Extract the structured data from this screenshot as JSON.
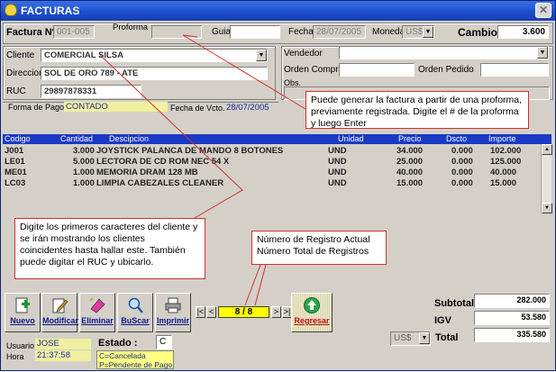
{
  "window": {
    "title": "FACTURAS"
  },
  "header": {
    "factura_label": "Factura Nº",
    "factura_value": "001-005",
    "proforma_label": "Proforma",
    "proforma_value": "",
    "guia_label": "Guia",
    "guia_value": "",
    "fecha_label": "Fecha:",
    "fecha_value": "28/07/2005",
    "moneda_label": "Moneda",
    "moneda_value": "US$",
    "cambio_label": "Cambio",
    "cambio_value": "3.600"
  },
  "client": {
    "cliente_label": "Cliente",
    "cliente_value": "COMERCIAL SILSA",
    "direccion_label": "Direccion",
    "direccion_value": "SOL DE ORO 789  - ATE",
    "ruc_label": "RUC",
    "ruc_value": "29897878331",
    "vendedor_label": "Vendedor",
    "vendedor_value": "",
    "orden_compra_label": "Orden Compra",
    "orden_compra_value": "",
    "orden_pedido_label": "Orden Pedido",
    "orden_pedido_value": "",
    "obs_label": "Obs."
  },
  "payment": {
    "forma_label": "Forma de Pago",
    "forma_value": "CONTADO",
    "vcto_label": "Fecha de Vcto.",
    "vcto_value": "28/07/2005"
  },
  "grid": {
    "columns": [
      "Codigo",
      "Cantidad",
      "Descipcion",
      "Unidad",
      "Precio",
      "Dscto",
      "Importe"
    ],
    "rows": [
      {
        "codigo": "J001",
        "cantidad": "3.000",
        "descripcion": "JOYSTICK PALANCA DE MANDO 8 BOTONES",
        "unidad": "UND",
        "precio": "34.000",
        "dscto": "0.000",
        "importe": "102.000"
      },
      {
        "codigo": "LE01",
        "cantidad": "5.000",
        "descripcion": "LECTORA DE CD ROM NEC 54 X",
        "unidad": "UND",
        "precio": "25.000",
        "dscto": "0.000",
        "importe": "125.000"
      },
      {
        "codigo": "ME01",
        "cantidad": "1.000",
        "descripcion": "MEMORIA DRAM 128 MB",
        "unidad": "UND",
        "precio": "40.000",
        "dscto": "0.000",
        "importe": "40.000"
      },
      {
        "codigo": "LC03",
        "cantidad": "1.000",
        "descripcion": "LIMPIA CABEZALES CLEANER",
        "unidad": "UND",
        "precio": "15.000",
        "dscto": "0.000",
        "importe": "15.000"
      }
    ]
  },
  "callouts": {
    "proforma": "Puede generar la factura a partir de una proforma, previamente registrada. Digite el # de la proforma y luego Enter",
    "cliente": "Digite los primeros caracteres del cliente y se irán mostrando los clientes coincidentes hasta hallar este. También puede digitar el RUC y ubicarlo.",
    "registro_line1": "Número de Registro Actual",
    "registro_line2": "Número Total de Registros"
  },
  "toolbar": {
    "nuevo": "Nuevo",
    "modificar": "Modificar",
    "eliminar": "Eliminar",
    "buscar": "BuScar",
    "imprimir": "Imprimir",
    "regresar": "Regresar"
  },
  "navigator": {
    "position": "8 / 8",
    "first": "|<",
    "prev": "<",
    "next": ">",
    "last": ">|"
  },
  "totals": {
    "subtotal_label": "Subtotal",
    "subtotal_value": "282.000",
    "igv_label": "IGV",
    "igv_value": "53.580",
    "total_label": "Total",
    "total_value": "335.580",
    "currency": "US$"
  },
  "footer": {
    "usuario_label": "Usuario",
    "usuario_value": "JOSE",
    "hora_label": "Hora",
    "hora_value": "21:37:58",
    "estado_label": "Estado :",
    "estado_value": "C",
    "estado_legend_1": "C=Cancelada",
    "estado_legend_2": "P=Pendente de Pago"
  },
  "colors": {
    "titlebar": "#1c4fcf",
    "grid_header": "#1a3ac6",
    "callout_border": "#d03030",
    "navigator_fill": "#ffff00",
    "estado_legend_fill": "#ffff80"
  }
}
